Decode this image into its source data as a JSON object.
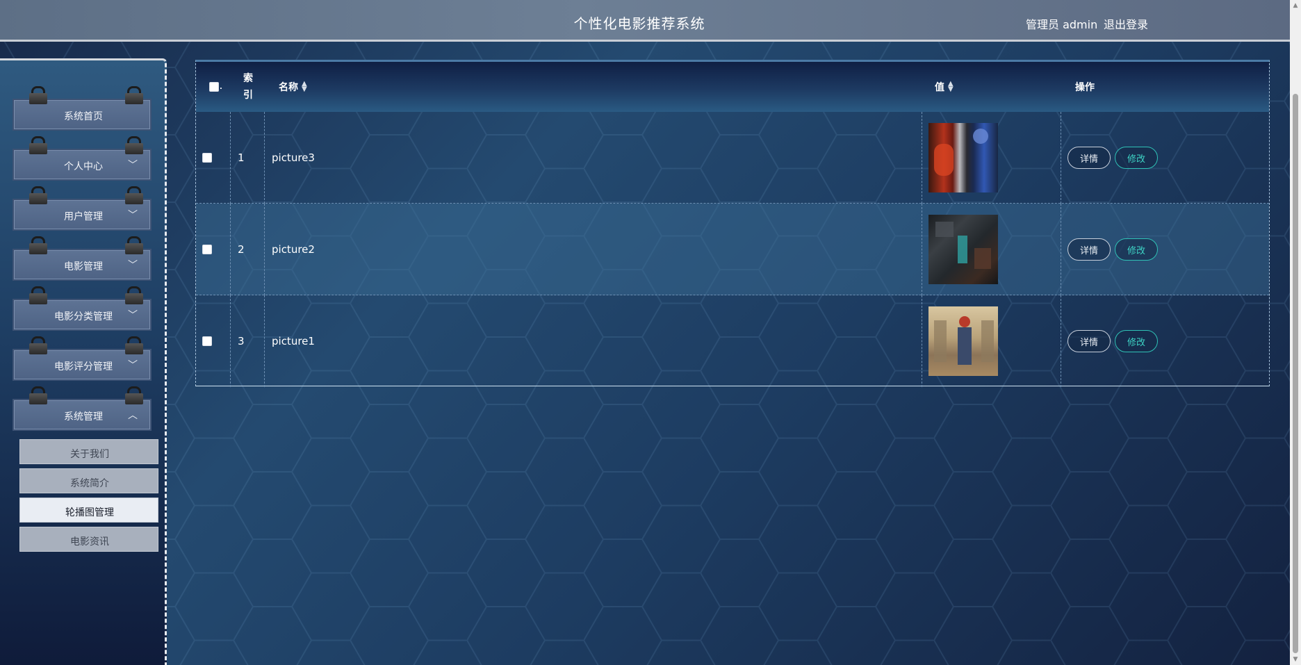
{
  "header": {
    "title": "个性化电影推荐系统",
    "user": "管理员 admin",
    "logout": "退出登录"
  },
  "sidebar": {
    "items": [
      {
        "label": "系统首页",
        "chevron": ""
      },
      {
        "label": "个人中心",
        "chevron": "﹀"
      },
      {
        "label": "用户管理",
        "chevron": "﹀"
      },
      {
        "label": "电影管理",
        "chevron": "﹀"
      },
      {
        "label": "电影分类管理",
        "chevron": "﹀"
      },
      {
        "label": "电影评分管理",
        "chevron": "﹀"
      },
      {
        "label": "系统管理",
        "chevron": "︿"
      }
    ],
    "subitems": [
      {
        "label": "关于我们",
        "active": false
      },
      {
        "label": "系统简介",
        "active": false
      },
      {
        "label": "轮播图管理",
        "active": true
      },
      {
        "label": "电影资讯",
        "active": false
      }
    ]
  },
  "table": {
    "headers": {
      "select": "",
      "index": "索引",
      "name": "名称",
      "value": "值",
      "actions": "操作"
    },
    "rows": [
      {
        "index": "1",
        "name": "picture3",
        "thumb": "red-blue-poster"
      },
      {
        "index": "2",
        "name": "picture2",
        "thumb": "dark-teal-poster"
      },
      {
        "index": "3",
        "name": "picture1",
        "thumb": "castle-poster"
      }
    ],
    "detail_label": "详情",
    "edit_label": "修改"
  },
  "colors": {
    "edit_accent": "#3ed3c5",
    "header_bg": "#6d7f95",
    "active_sub": "#e9edf3"
  }
}
